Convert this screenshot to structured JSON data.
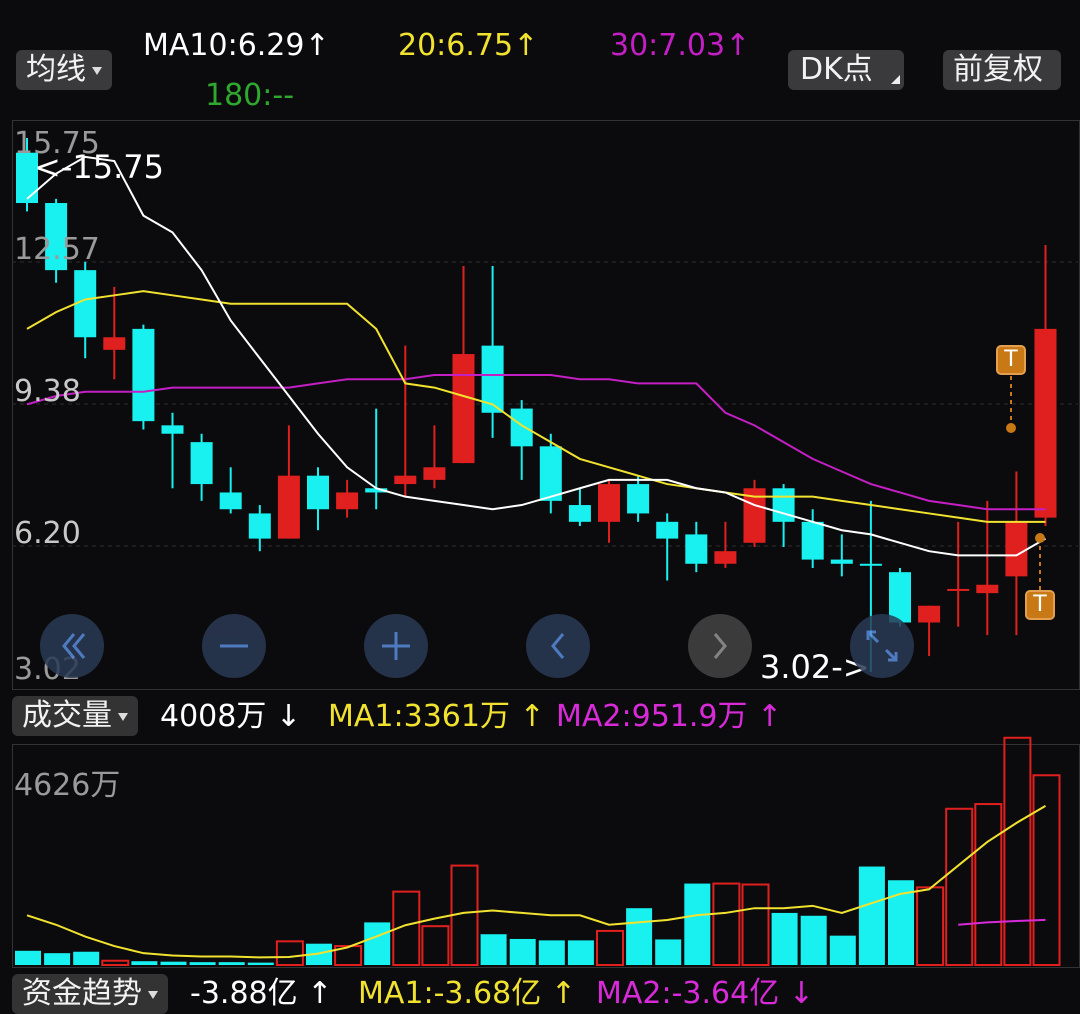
{
  "header": {
    "ma_button": "均线",
    "ma10": "MA10:6.29",
    "ma20": "20:6.75",
    "ma30": "30:7.03",
    "ma180": "180:--",
    "arrow_up": "↑",
    "arrow_down": "↓",
    "dk_button": "DK点",
    "fq_button": "前复权"
  },
  "price_chart": {
    "y_labels": [
      "15.75",
      "12.57",
      "9.38",
      "6.20",
      "3.02"
    ],
    "high_label": "<-15.75",
    "low_label": "3.02->",
    "marker_T": "T"
  },
  "volume_header": {
    "menu": "成交量",
    "value": "4008万",
    "ma1": "MA1:3361万",
    "ma2": "MA2:951.9万",
    "y_top": "4626万"
  },
  "fund_header": {
    "menu": "资金趋势",
    "value": "-3.88亿",
    "ma1": "MA1:-3.68亿",
    "ma2": "MA2:-3.64亿"
  },
  "colors": {
    "up": "#e0201e",
    "down": "#19f0f0",
    "ma10": "#ffffff",
    "ma20": "#f2e230",
    "ma30": "#c41fc4",
    "ma180": "#2ea82e",
    "marker": "#c87814"
  },
  "icons": [
    "double-left-icon",
    "zoom-out-icon",
    "zoom-in-icon",
    "left-icon",
    "right-icon",
    "fullscreen-icon"
  ],
  "chart_data": {
    "type": "candlestick",
    "price_range": [
      3.02,
      15.75
    ],
    "candles": [
      {
        "o": 15.4,
        "c": 14.2,
        "h": 15.75,
        "l": 14.0,
        "up": false
      },
      {
        "o": 14.2,
        "c": 12.6,
        "h": 14.3,
        "l": 12.3,
        "up": false
      },
      {
        "o": 12.6,
        "c": 11.0,
        "h": 12.8,
        "l": 10.5,
        "up": false
      },
      {
        "o": 10.7,
        "c": 11.0,
        "h": 12.2,
        "l": 10.0,
        "up": true
      },
      {
        "o": 11.2,
        "c": 9.0,
        "h": 11.3,
        "l": 8.8,
        "up": false
      },
      {
        "o": 8.9,
        "c": 8.7,
        "h": 9.2,
        "l": 7.4,
        "up": false
      },
      {
        "o": 8.5,
        "c": 7.5,
        "h": 8.7,
        "l": 7.1,
        "up": false
      },
      {
        "o": 7.3,
        "c": 6.9,
        "h": 7.9,
        "l": 6.8,
        "up": false
      },
      {
        "o": 6.8,
        "c": 6.2,
        "h": 7.0,
        "l": 5.9,
        "up": false
      },
      {
        "o": 6.2,
        "c": 7.7,
        "h": 8.9,
        "l": 6.2,
        "up": true
      },
      {
        "o": 7.7,
        "c": 6.9,
        "h": 7.9,
        "l": 6.4,
        "up": false
      },
      {
        "o": 6.9,
        "c": 7.3,
        "h": 7.6,
        "l": 6.7,
        "up": true
      },
      {
        "o": 7.4,
        "c": 7.3,
        "h": 9.3,
        "l": 6.9,
        "up": false
      },
      {
        "o": 7.5,
        "c": 7.7,
        "h": 10.8,
        "l": 7.2,
        "up": true
      },
      {
        "o": 7.6,
        "c": 7.9,
        "h": 8.9,
        "l": 7.4,
        "up": true
      },
      {
        "o": 8.0,
        "c": 10.6,
        "h": 12.7,
        "l": 8.0,
        "up": true
      },
      {
        "o": 10.8,
        "c": 9.2,
        "h": 12.7,
        "l": 8.6,
        "up": false
      },
      {
        "o": 9.3,
        "c": 8.4,
        "h": 9.5,
        "l": 7.6,
        "up": false
      },
      {
        "o": 8.4,
        "c": 7.1,
        "h": 8.7,
        "l": 6.8,
        "up": false
      },
      {
        "o": 7.0,
        "c": 6.6,
        "h": 7.4,
        "l": 6.5,
        "up": false
      },
      {
        "o": 6.6,
        "c": 7.5,
        "h": 7.6,
        "l": 6.1,
        "up": true
      },
      {
        "o": 7.5,
        "c": 6.8,
        "h": 7.7,
        "l": 6.6,
        "up": false
      },
      {
        "o": 6.6,
        "c": 6.2,
        "h": 6.8,
        "l": 5.2,
        "up": false
      },
      {
        "o": 6.3,
        "c": 5.6,
        "h": 6.6,
        "l": 5.4,
        "up": false
      },
      {
        "o": 5.6,
        "c": 5.9,
        "h": 6.6,
        "l": 5.5,
        "up": true
      },
      {
        "o": 6.1,
        "c": 7.4,
        "h": 7.6,
        "l": 6.0,
        "up": true
      },
      {
        "o": 7.4,
        "c": 6.6,
        "h": 7.5,
        "l": 6.0,
        "up": false
      },
      {
        "o": 6.6,
        "c": 5.7,
        "h": 6.9,
        "l": 5.5,
        "up": false
      },
      {
        "o": 5.7,
        "c": 5.6,
        "h": 6.3,
        "l": 5.3,
        "up": false
      },
      {
        "o": 5.6,
        "c": 5.6,
        "h": 7.1,
        "l": 3.02,
        "up": false
      },
      {
        "o": 5.4,
        "c": 4.2,
        "h": 5.5,
        "l": 4.1,
        "up": false
      },
      {
        "o": 4.2,
        "c": 4.6,
        "h": 4.6,
        "l": 3.4,
        "up": true
      },
      {
        "o": 5.0,
        "c": 5.0,
        "h": 6.6,
        "l": 4.1,
        "up": true
      },
      {
        "o": 4.9,
        "c": 5.1,
        "h": 7.1,
        "l": 3.9,
        "up": true
      },
      {
        "o": 5.3,
        "c": 6.6,
        "h": 7.8,
        "l": 3.9,
        "up": true
      },
      {
        "o": 6.7,
        "c": 11.2,
        "h": 13.2,
        "l": 6.5,
        "up": true
      }
    ],
    "ma10": [
      14.3,
      14.9,
      15.3,
      15.2,
      13.9,
      13.5,
      12.6,
      11.4,
      10.5,
      9.6,
      8.7,
      7.9,
      7.4,
      7.2,
      7.1,
      7.0,
      6.9,
      7.0,
      7.2,
      7.4,
      7.6,
      7.6,
      7.6,
      7.4,
      7.3,
      7.0,
      6.8,
      6.6,
      6.4,
      6.3,
      6.1,
      5.9,
      5.8,
      5.8,
      5.8,
      6.2
    ],
    "ma20": [
      11.2,
      11.6,
      11.9,
      12.0,
      12.1,
      12.0,
      11.9,
      11.8,
      11.8,
      11.8,
      11.8,
      11.8,
      11.2,
      9.9,
      9.8,
      9.6,
      9.4,
      8.9,
      8.5,
      8.1,
      7.9,
      7.7,
      7.5,
      7.4,
      7.3,
      7.2,
      7.2,
      7.2,
      7.1,
      7.0,
      6.9,
      6.8,
      6.7,
      6.6,
      6.6,
      6.6
    ],
    "ma30": [
      9.4,
      9.6,
      9.7,
      9.7,
      9.7,
      9.8,
      9.8,
      9.8,
      9.8,
      9.8,
      9.9,
      10.0,
      10.0,
      10.0,
      10.1,
      10.1,
      10.1,
      10.1,
      10.1,
      10.0,
      10.0,
      9.9,
      9.9,
      9.9,
      9.2,
      8.9,
      8.5,
      8.1,
      7.8,
      7.5,
      7.3,
      7.1,
      7.0,
      6.9,
      6.9,
      6.9
    ],
    "volume_max": 4626,
    "volume": [
      300,
      250,
      280,
      90,
      80,
      70,
      60,
      60,
      50,
      500,
      450,
      400,
      900,
      1550,
      820,
      2100,
      650,
      550,
      520,
      520,
      720,
      1200,
      540,
      1720,
      1720,
      1700,
      1100,
      1040,
      620,
      2080,
      1790,
      1640,
      3300,
      3400,
      4800,
      4008
    ],
    "volume_ma1": [
      1050,
      850,
      600,
      400,
      250,
      200,
      180,
      180,
      160,
      170,
      240,
      370,
      600,
      840,
      980,
      1100,
      1150,
      1100,
      1050,
      1050,
      850,
      900,
      950,
      1050,
      1100,
      1200,
      1200,
      1250,
      1100,
      1300,
      1500,
      1600,
      2100,
      2600,
      3000,
      3361
    ],
    "volume_ma2": [
      null,
      null,
      null,
      null,
      null,
      null,
      null,
      null,
      null,
      null,
      null,
      null,
      null,
      null,
      null,
      null,
      null,
      null,
      null,
      null,
      null,
      null,
      null,
      null,
      null,
      null,
      null,
      null,
      null,
      null,
      null,
      null,
      850,
      900,
      930,
      951.9
    ]
  }
}
